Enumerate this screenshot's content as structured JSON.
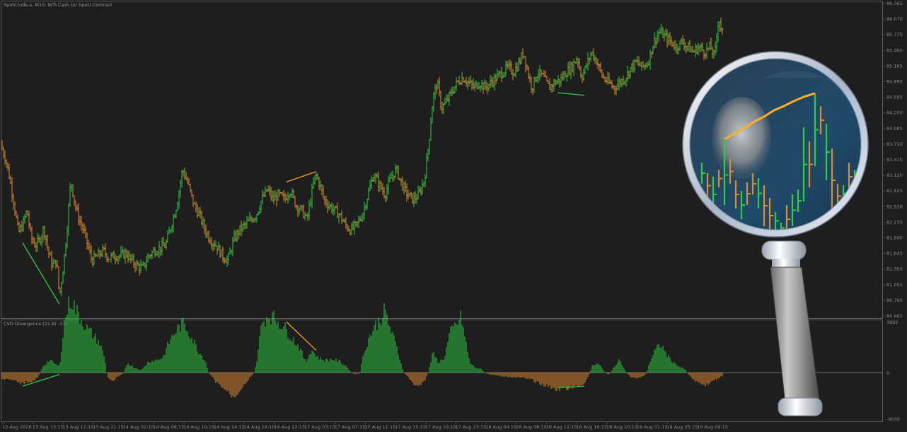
{
  "chart_data": [
    {
      "type": "bar",
      "title": "SpotCrude.a, M15:  WTI Cash (or Spot) Contract",
      "price_axis": [
        "86.365",
        "86.070",
        "85.775",
        "85.460",
        "85.165",
        "84.890",
        "84.595",
        "84.200",
        "84.005",
        "83.710",
        "83.415",
        "83.120",
        "82.825",
        "82.530",
        "82.235",
        "81.940",
        "81.645",
        "81.350",
        "81.055",
        "80.760",
        "80.465"
      ],
      "ylim": [
        80.465,
        86.365
      ],
      "close_path": [
        [
          0,
          83.6
        ],
        [
          8,
          83.3
        ],
        [
          14,
          82.9
        ],
        [
          20,
          82.4
        ],
        [
          26,
          81.85
        ],
        [
          32,
          82.0
        ],
        [
          38,
          82.3
        ],
        [
          44,
          81.75
        ],
        [
          50,
          81.6
        ],
        [
          56,
          81.7
        ],
        [
          62,
          81.95
        ],
        [
          68,
          81.5
        ],
        [
          74,
          81.2
        ],
        [
          80,
          81.3
        ],
        [
          84,
          80.6
        ],
        [
          88,
          81.0
        ],
        [
          94,
          81.8
        ],
        [
          100,
          82.9
        ],
        [
          106,
          82.4
        ],
        [
          112,
          82.1
        ],
        [
          118,
          81.9
        ],
        [
          124,
          81.6
        ],
        [
          130,
          81.3
        ],
        [
          138,
          81.4
        ],
        [
          146,
          81.5
        ],
        [
          154,
          81.35
        ],
        [
          162,
          81.4
        ],
        [
          170,
          81.4
        ],
        [
          178,
          81.45
        ],
        [
          186,
          81.3
        ],
        [
          194,
          81.2
        ],
        [
          202,
          81.15
        ],
        [
          210,
          81.4
        ],
        [
          218,
          81.5
        ],
        [
          226,
          81.55
        ],
        [
          234,
          81.6
        ],
        [
          242,
          82.0
        ],
        [
          250,
          82.4
        ],
        [
          258,
          83.1
        ],
        [
          266,
          82.8
        ],
        [
          274,
          82.4
        ],
        [
          282,
          82.2
        ],
        [
          290,
          81.9
        ],
        [
          298,
          81.7
        ],
        [
          306,
          81.6
        ],
        [
          314,
          81.4
        ],
        [
          322,
          81.3
        ],
        [
          330,
          81.7
        ],
        [
          338,
          81.9
        ],
        [
          346,
          82.0
        ],
        [
          354,
          82.1
        ],
        [
          362,
          82.2
        ],
        [
          370,
          82.5
        ],
        [
          378,
          82.7
        ],
        [
          386,
          82.5
        ],
        [
          394,
          82.6
        ],
        [
          402,
          82.5
        ],
        [
          410,
          82.7
        ],
        [
          418,
          82.4
        ],
        [
          426,
          82.3
        ],
        [
          434,
          82.1
        ],
        [
          440,
          82.6
        ],
        [
          446,
          83.0
        ],
        [
          452,
          82.8
        ],
        [
          458,
          82.5
        ],
        [
          464,
          82.4
        ],
        [
          472,
          82.3
        ],
        [
          480,
          82.2
        ],
        [
          488,
          82.0
        ],
        [
          496,
          81.9
        ],
        [
          504,
          82.0
        ],
        [
          512,
          82.2
        ],
        [
          520,
          82.6
        ],
        [
          528,
          83.0
        ],
        [
          536,
          82.8
        ],
        [
          544,
          82.6
        ],
        [
          552,
          82.9
        ],
        [
          560,
          83.1
        ],
        [
          568,
          82.8
        ],
        [
          576,
          82.6
        ],
        [
          584,
          82.5
        ],
        [
          592,
          82.6
        ],
        [
          600,
          82.9
        ],
        [
          606,
          83.6
        ],
        [
          612,
          84.5
        ],
        [
          618,
          84.8
        ],
        [
          624,
          84.3
        ],
        [
          630,
          84.4
        ],
        [
          638,
          84.6
        ],
        [
          646,
          84.8
        ],
        [
          654,
          84.9
        ],
        [
          662,
          84.8
        ],
        [
          670,
          84.7
        ],
        [
          678,
          84.8
        ],
        [
          686,
          84.7
        ],
        [
          694,
          84.8
        ],
        [
          702,
          84.9
        ],
        [
          710,
          85.0
        ],
        [
          718,
          85.1
        ],
        [
          726,
          85.0
        ],
        [
          734,
          85.2
        ],
        [
          740,
          85.4
        ],
        [
          746,
          85.0
        ],
        [
          752,
          84.7
        ],
        [
          760,
          85.0
        ],
        [
          768,
          84.9
        ],
        [
          776,
          84.7
        ],
        [
          784,
          84.8
        ],
        [
          792,
          84.85
        ],
        [
          800,
          85.0
        ],
        [
          808,
          85.1
        ],
        [
          816,
          85.3
        ],
        [
          822,
          84.9
        ],
        [
          828,
          85.1
        ],
        [
          836,
          85.4
        ],
        [
          844,
          85.2
        ],
        [
          852,
          84.9
        ],
        [
          860,
          84.8
        ],
        [
          868,
          84.7
        ],
        [
          876,
          84.8
        ],
        [
          884,
          84.9
        ],
        [
          892,
          85.1
        ],
        [
          900,
          85.2
        ],
        [
          908,
          85.1
        ],
        [
          916,
          85.2
        ],
        [
          924,
          85.6
        ],
        [
          932,
          85.8
        ],
        [
          940,
          85.7
        ],
        [
          948,
          85.6
        ],
        [
          956,
          85.5
        ],
        [
          964,
          85.6
        ],
        [
          972,
          85.5
        ],
        [
          980,
          85.4
        ],
        [
          988,
          85.5
        ],
        [
          996,
          85.4
        ],
        [
          1004,
          85.5
        ],
        [
          1010,
          85.3
        ],
        [
          1016,
          86.1
        ],
        [
          1020,
          85.8
        ]
      ],
      "divergence_lines": [
        {
          "color": "#2ecc40",
          "from": [
            32,
            81.65
          ],
          "to": [
            84,
            80.45
          ]
        },
        {
          "color": "#ff9f1a",
          "from": [
            405,
            82.85
          ],
          "to": [
            447,
            83.05
          ]
        },
        {
          "color": "#2ecc40",
          "from": [
            788,
            84.6
          ],
          "to": [
            826,
            84.55
          ]
        }
      ]
    },
    {
      "type": "bar",
      "title": "CVD Divergence (21,8)  -37k",
      "axis": [
        "3662",
        "0",
        "-9030"
      ],
      "ylim": [
        -9030,
        3662
      ],
      "value_path": [
        [
          0,
          -1200
        ],
        [
          20,
          -1800
        ],
        [
          32,
          -2400
        ],
        [
          50,
          -1600
        ],
        [
          60,
          500
        ],
        [
          70,
          1000
        ],
        [
          84,
          500
        ],
        [
          92,
          4500
        ],
        [
          100,
          6000
        ],
        [
          108,
          5000
        ],
        [
          116,
          4200
        ],
        [
          124,
          3500
        ],
        [
          132,
          3000
        ],
        [
          140,
          2500
        ],
        [
          148,
          1200
        ],
        [
          154,
          -1500
        ],
        [
          160,
          -1800
        ],
        [
          166,
          -800
        ],
        [
          172,
          -400
        ],
        [
          180,
          800
        ],
        [
          190,
          400
        ],
        [
          200,
          200
        ],
        [
          210,
          900
        ],
        [
          220,
          1000
        ],
        [
          230,
          1200
        ],
        [
          240,
          2600
        ],
        [
          250,
          3500
        ],
        [
          260,
          4000
        ],
        [
          270,
          3000
        ],
        [
          280,
          1800
        ],
        [
          290,
          1000
        ],
        [
          298,
          -600
        ],
        [
          306,
          -2200
        ],
        [
          314,
          -3200
        ],
        [
          322,
          -4200
        ],
        [
          330,
          -5500
        ],
        [
          338,
          -4000
        ],
        [
          346,
          -2500
        ],
        [
          354,
          -1000
        ],
        [
          362,
          600
        ],
        [
          370,
          4000
        ],
        [
          380,
          4700
        ],
        [
          390,
          4300
        ],
        [
          400,
          3800
        ],
        [
          408,
          3200
        ],
        [
          416,
          2600
        ],
        [
          424,
          2000
        ],
        [
          432,
          800
        ],
        [
          440,
          1900
        ],
        [
          450,
          1200
        ],
        [
          460,
          1000
        ],
        [
          470,
          1100
        ],
        [
          480,
          900
        ],
        [
          490,
          500
        ],
        [
          500,
          -300
        ],
        [
          508,
          -200
        ],
        [
          514,
          1500
        ],
        [
          520,
          2600
        ],
        [
          528,
          3600
        ],
        [
          536,
          4200
        ],
        [
          544,
          5000
        ],
        [
          552,
          3500
        ],
        [
          560,
          2200
        ],
        [
          568,
          500
        ],
        [
          576,
          -800
        ],
        [
          584,
          -2400
        ],
        [
          592,
          -3000
        ],
        [
          600,
          -2000
        ],
        [
          606,
          200
        ],
        [
          612,
          1600
        ],
        [
          620,
          800
        ],
        [
          628,
          1200
        ],
        [
          636,
          3200
        ],
        [
          644,
          3800
        ],
        [
          652,
          4500
        ],
        [
          658,
          2600
        ],
        [
          664,
          800
        ],
        [
          672,
          400
        ],
        [
          680,
          300
        ],
        [
          690,
          -300
        ],
        [
          700,
          -600
        ],
        [
          710,
          -800
        ],
        [
          720,
          -900
        ],
        [
          730,
          -1000
        ],
        [
          740,
          -1200
        ],
        [
          750,
          -1500
        ],
        [
          760,
          -2200
        ],
        [
          770,
          -2800
        ],
        [
          780,
          -3300
        ],
        [
          790,
          -3600
        ],
        [
          800,
          -3500
        ],
        [
          810,
          -3300
        ],
        [
          820,
          -3000
        ],
        [
          828,
          -1800
        ],
        [
          836,
          500
        ],
        [
          844,
          800
        ],
        [
          852,
          300
        ],
        [
          860,
          -400
        ],
        [
          868,
          500
        ],
        [
          876,
          1000
        ],
        [
          884,
          200
        ],
        [
          892,
          -1000
        ],
        [
          900,
          -1200
        ],
        [
          910,
          -800
        ],
        [
          918,
          800
        ],
        [
          926,
          1800
        ],
        [
          934,
          2300
        ],
        [
          942,
          1500
        ],
        [
          950,
          900
        ],
        [
          960,
          500
        ],
        [
          970,
          200
        ],
        [
          978,
          -1200
        ],
        [
          988,
          -2200
        ],
        [
          996,
          -2800
        ],
        [
          1004,
          -2200
        ],
        [
          1012,
          -1500
        ],
        [
          1020,
          -800
        ]
      ],
      "divergence_lines": [
        {
          "color": "#2ecc40",
          "from": [
            32,
            -3000
          ],
          "to": [
            84,
            -400
          ]
        },
        {
          "color": "#ff9f1a",
          "from": [
            405,
            4100
          ],
          "to": [
            447,
            1800
          ]
        },
        {
          "color": "#2ecc40",
          "from": [
            788,
            -3300
          ],
          "to": [
            826,
            -3000
          ]
        }
      ]
    }
  ],
  "time_axis": [
    "13 Aug 2026",
    "13 Aug 13:15",
    "13 Aug 17:15",
    "13 Aug 21:15",
    "14 Aug 02:15",
    "14 Aug 06:15",
    "14 Aug 10:15",
    "14 Aug 14:15",
    "14 Aug 18:15",
    "14 Aug 22:15",
    "17 Aug 03:15",
    "17 Aug 07:15",
    "17 Aug 11:15",
    "17 Aug 15:15",
    "17 Aug 19:15",
    "17 Aug 23:15",
    "18 Aug 04:15",
    "18 Aug 08:15",
    "18 Aug 12:15",
    "18 Aug 16:15",
    "18 Aug 20:15",
    "19 Aug 01:15",
    "19 Aug 05:15",
    "19 Aug 09:15"
  ],
  "colors": {
    "up": "#2ecc40",
    "down": "#e08a2e",
    "bg": "#1e1e1e",
    "grid": "#4a4a4a",
    "axis_text": "#8a8a8a",
    "magnifier_orange": "#ff9f1a"
  },
  "magnifier": {
    "icon": "magnifying-glass-icon"
  }
}
